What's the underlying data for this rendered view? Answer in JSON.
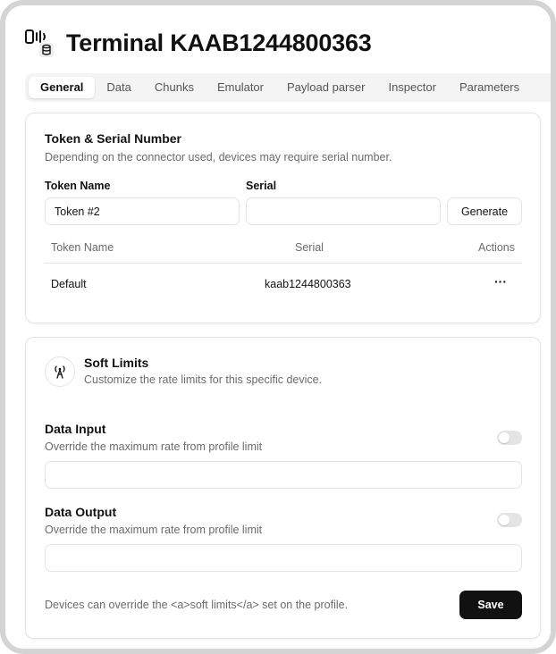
{
  "header": {
    "title": "Terminal KAAB1244800363",
    "icon": "device-database-icon"
  },
  "tabs": [
    {
      "label": "General",
      "active": true
    },
    {
      "label": "Data"
    },
    {
      "label": "Chunks"
    },
    {
      "label": "Emulator"
    },
    {
      "label": "Payload parser"
    },
    {
      "label": "Inspector"
    },
    {
      "label": "Parameters"
    }
  ],
  "token_section": {
    "title": "Token & Serial Number",
    "description": "Depending on the connector used, devices may require serial number.",
    "token_name_label": "Token Name",
    "token_name_value": "Token #2",
    "serial_label": "Serial",
    "serial_value": "",
    "generate_label": "Generate",
    "table": {
      "columns": [
        "Token Name",
        "Serial",
        "Actions"
      ],
      "rows": [
        {
          "token_name": "Default",
          "serial": "kaab1244800363",
          "actions": "···"
        }
      ]
    }
  },
  "soft_limits": {
    "icon": "antenna-tower-icon",
    "title": "Soft Limits",
    "description": "Customize the rate limits for this specific device.",
    "data_input": {
      "title": "Data Input",
      "description": "Override the maximum rate from profile limit",
      "enabled": false,
      "value": ""
    },
    "data_output": {
      "title": "Data Output",
      "description": "Override the maximum rate from profile limit",
      "enabled": false,
      "value": ""
    },
    "footer_note": "Devices can override the <a>soft limits</a> set on the profile.",
    "save_label": "Save"
  }
}
